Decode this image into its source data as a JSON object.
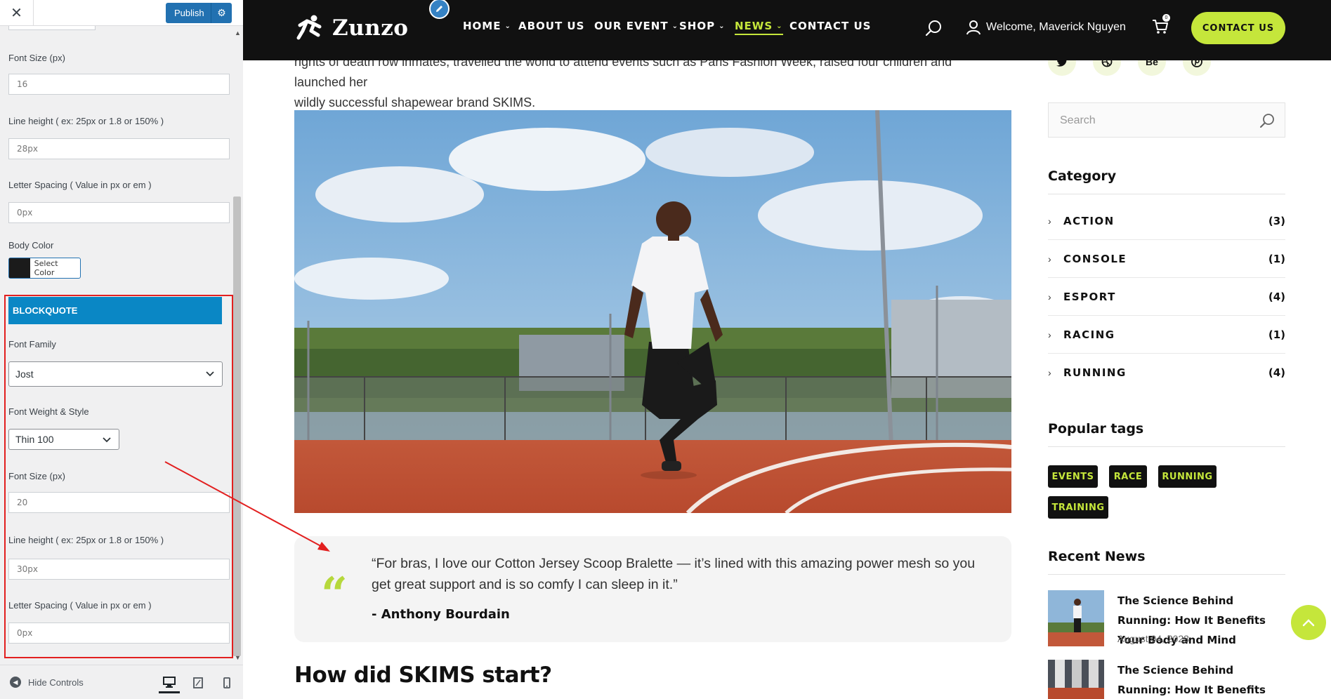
{
  "customizer": {
    "close_label": "✕",
    "publish_label": "Publish",
    "body_section": {
      "font_size_label": "Font Size (px)",
      "font_size_value": "16",
      "line_height_label": "Line height ( ex: 25px or 1.8 or 150% )",
      "line_height_value": "28px",
      "letter_spacing_label": "Letter Spacing ( Value in px or em )",
      "letter_spacing_value": "0px",
      "color_label": "Body Color",
      "color_button_label": "Select Color",
      "color_value": "#1b1b1b"
    },
    "blockquote_section": {
      "header": "BLOCKQUOTE",
      "font_family_label": "Font Family",
      "font_family_value": "Jost",
      "font_weight_label": "Font Weight & Style",
      "font_weight_value": "Thin 100",
      "font_size_label": "Font Size (px)",
      "font_size_value": "20",
      "line_height_label": "Line height ( ex: 25px or 1.8 or 150% )",
      "line_height_value": "30px",
      "letter_spacing_label": "Letter Spacing ( Value in px or em )",
      "letter_spacing_value": "0px"
    },
    "footer": {
      "hide_controls_label": "Hide Controls"
    }
  },
  "site": {
    "logo_text": "Zunzo",
    "nav": [
      {
        "label": "HOME",
        "has_dropdown": true
      },
      {
        "label": "ABOUT US",
        "has_dropdown": false
      },
      {
        "label": "OUR EVENT",
        "has_dropdown": true
      },
      {
        "label": "SHOP",
        "has_dropdown": true
      },
      {
        "label": "NEWS",
        "has_dropdown": true,
        "active": true
      },
      {
        "label": "CONTACT US",
        "has_dropdown": false
      }
    ],
    "welcome_text": "Welcome, Maverick Nguyen",
    "cart_count": "0",
    "contact_button": "CONTACT US",
    "accent_color": "#c5e63b"
  },
  "article": {
    "intro_line1": "rights of death row inmates, travelled the world to attend events such as Paris Fashion Week, raised four children and launched her",
    "intro_line2": "wildly successful shapewear brand SKIMS.",
    "quote_mark": "“",
    "quote_text": "“For bras, I love our Cotton Jersey Scoop Bralette — it’s lined with this amazing power mesh so you get great support and is so comfy I can sleep in it.”",
    "quote_author": "- Anthony Bourdain",
    "section_heading": "How did SKIMS start?"
  },
  "sidebar": {
    "social_icons": [
      "twitter-icon",
      "dribbble-icon",
      "behance-icon",
      "pinterest-icon"
    ],
    "behance_label": "Be",
    "search_placeholder": "Search",
    "category_title": "Category",
    "categories": [
      {
        "name": "ACTION",
        "count": "(3)"
      },
      {
        "name": "CONSOLE",
        "count": "(1)"
      },
      {
        "name": "ESPORT",
        "count": "(4)"
      },
      {
        "name": "RACING",
        "count": "(1)"
      },
      {
        "name": "RUNNING",
        "count": "(4)"
      }
    ],
    "tags_title": "Popular tags",
    "tags": [
      "EVENTS",
      "RACE",
      "RUNNING",
      "TRAINING"
    ],
    "recent_title": "Recent News",
    "recent_news": [
      {
        "title": "The Science Behind Running: How It Benefits Your Body and Mind",
        "date": "August 04, 2023"
      },
      {
        "title": "The Science Behind Running: How It Benefits Your Body and Mind",
        "date": ""
      }
    ]
  }
}
